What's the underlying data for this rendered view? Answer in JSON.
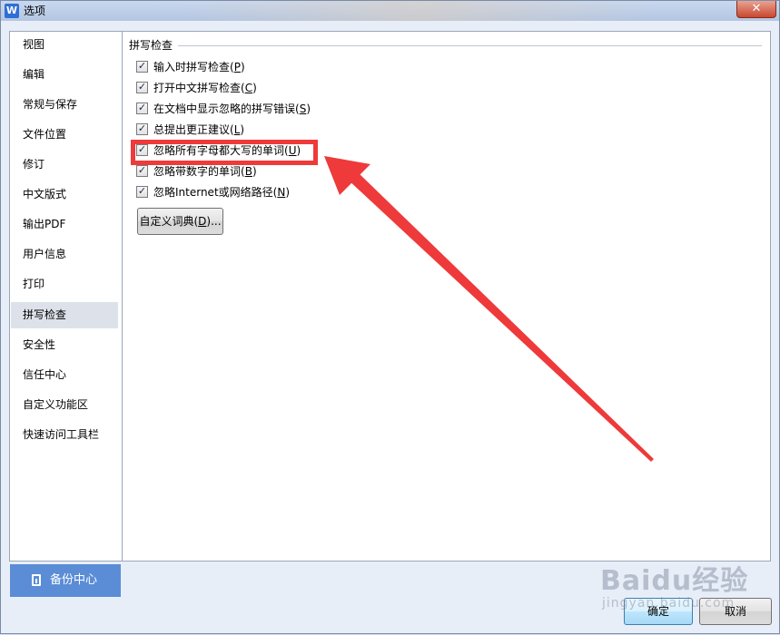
{
  "window": {
    "icon_glyph": "W",
    "title": "选项",
    "close_glyph": "✕"
  },
  "sidebar": {
    "items": [
      {
        "label": "视图"
      },
      {
        "label": "编辑"
      },
      {
        "label": "常规与保存"
      },
      {
        "label": "文件位置"
      },
      {
        "label": "修订"
      },
      {
        "label": "中文版式"
      },
      {
        "label": "输出PDF"
      },
      {
        "label": "用户信息"
      },
      {
        "label": "打印"
      },
      {
        "label": "拼写检查",
        "selected": true
      },
      {
        "label": "安全性"
      },
      {
        "label": "信任中心"
      },
      {
        "label": "自定义功能区"
      },
      {
        "label": "快速访问工具栏"
      }
    ],
    "backup_label": "备份中心"
  },
  "spellcheck": {
    "section_title": "拼写检查",
    "options": [
      {
        "label": "输入时拼写检查",
        "key": "P",
        "checked": true
      },
      {
        "label": "打开中文拼写检查",
        "key": "C",
        "checked": true
      },
      {
        "label": "在文档中显示忽略的拼写错误",
        "key": "S",
        "checked": true
      },
      {
        "label": "总提出更正建议",
        "key": "L",
        "checked": true
      },
      {
        "label": "忽略所有字母都大写的单词",
        "key": "U",
        "checked": true
      },
      {
        "label": "忽略带数字的单词",
        "key": "B",
        "checked": true
      },
      {
        "label": "忽略Internet或网络路径",
        "key": "N",
        "checked": true
      }
    ],
    "custom_dict": {
      "label": "自定义词典",
      "key": "D",
      "suffix": "..."
    }
  },
  "footer": {
    "ok_label": "确定",
    "cancel_label": "取消"
  },
  "watermark": {
    "main": "Baidu经验",
    "sub": "jingyan.baidu.com"
  },
  "annotation": {
    "highlight_color": "#ee3a3a",
    "highlight_option_index": 4
  }
}
